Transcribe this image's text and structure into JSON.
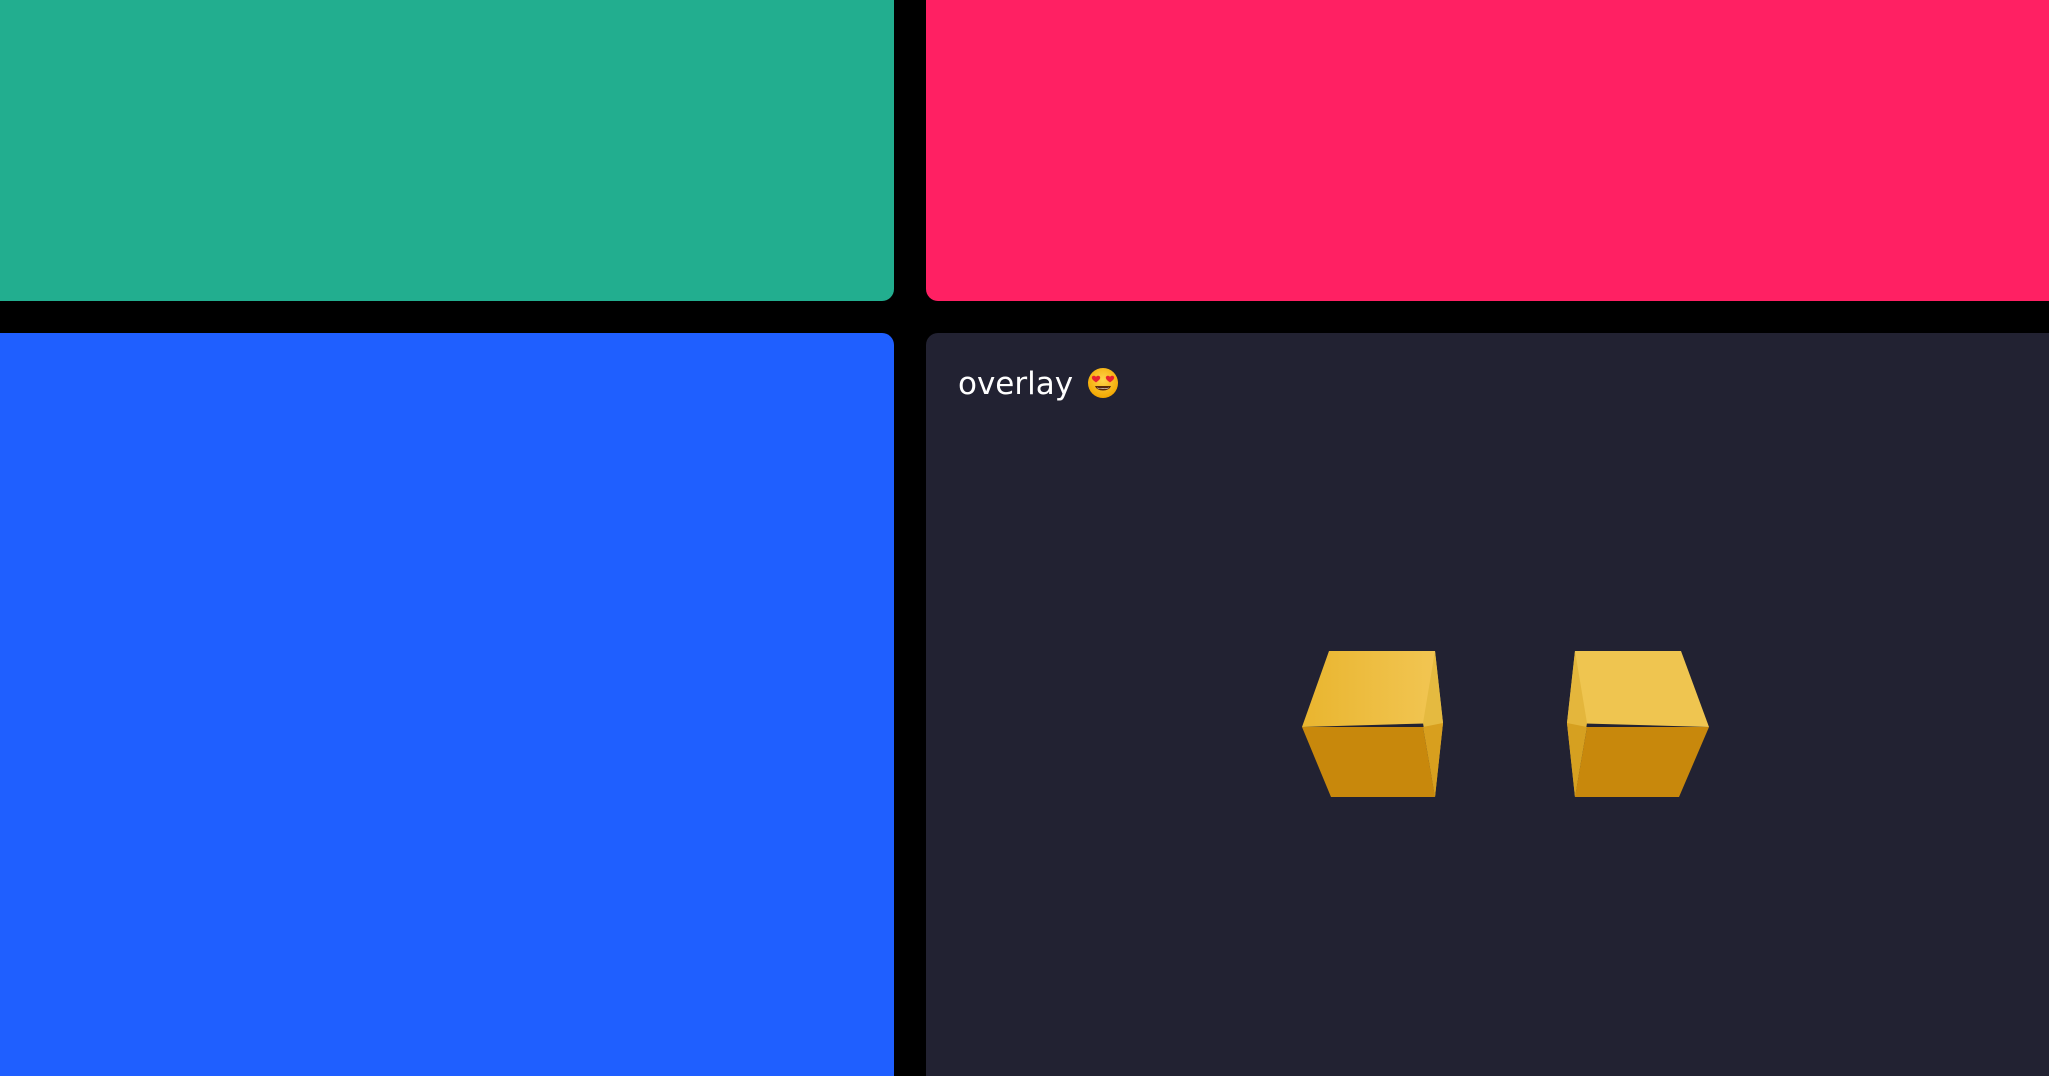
{
  "panels": {
    "top_left": {
      "color": "#22ae8f"
    },
    "top_right": {
      "color": "#ff2063"
    },
    "bottom_left": {
      "color": "#1f5fff"
    },
    "bottom_right": {
      "color": "#222232",
      "overlay_label": "overlay",
      "overlay_emoji": "smiling-face-with-heart-eyes-icon"
    }
  },
  "cubes": {
    "color_top": "#efc24a",
    "color_front": "#c8880c",
    "color_side": "#e0b43a",
    "icons": [
      "cube-icon",
      "cube-icon"
    ]
  }
}
